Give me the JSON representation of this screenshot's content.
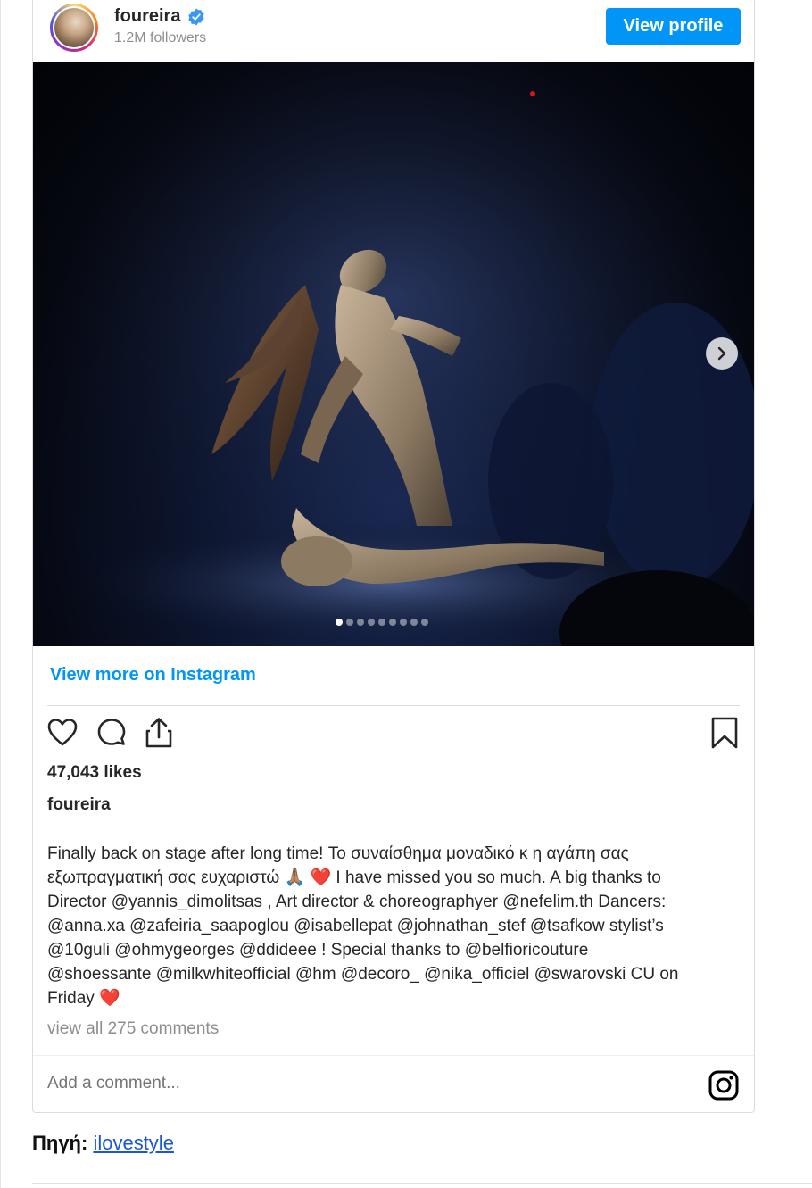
{
  "header": {
    "username": "foureira",
    "followers": "1.2M followers",
    "view_profile_label": "View profile"
  },
  "carousel": {
    "slide_count": 9,
    "active_index": 0
  },
  "view_more_label": "View more on Instagram",
  "likes": "47,043 likes",
  "caption": {
    "username": "foureira",
    "line1": "Finally back on stage after long time! Το συναίσθημα μοναδικό κ η αγάπη σας",
    "line2_pre": "εξωπραγματική σας ευχαριστώ",
    "line2_post": "I have missed you so much. A big thanks to",
    "line3": "Director @yannis_dimolitsas , Art director & choreographyer @nefelim.th Dancers:",
    "line4": "@anna.xa @zafeiria_saapoglou @isabellepat @johnathan_stef @tsafkow stylist’s",
    "line5": "@10guli @ohmygeorges @ddideee ! Special thanks to @belfioricouture",
    "line6": "@shoessante @milkwhiteofficial @hm @decoro_ @nika_officiel @swarovski CU on",
    "line7": "Friday",
    "emoji_pray": "🙏🏽",
    "emoji_heart": "❤️"
  },
  "view_comments_label": "view all 275 comments",
  "comment_input": {
    "placeholder": "Add a comment..."
  },
  "source": {
    "label": "Πηγή:",
    "link_text": "ilovestyle"
  },
  "colors": {
    "accent": "#0095f6",
    "link": "#1a56db",
    "muted": "#8e8e8e",
    "text": "#262626"
  }
}
